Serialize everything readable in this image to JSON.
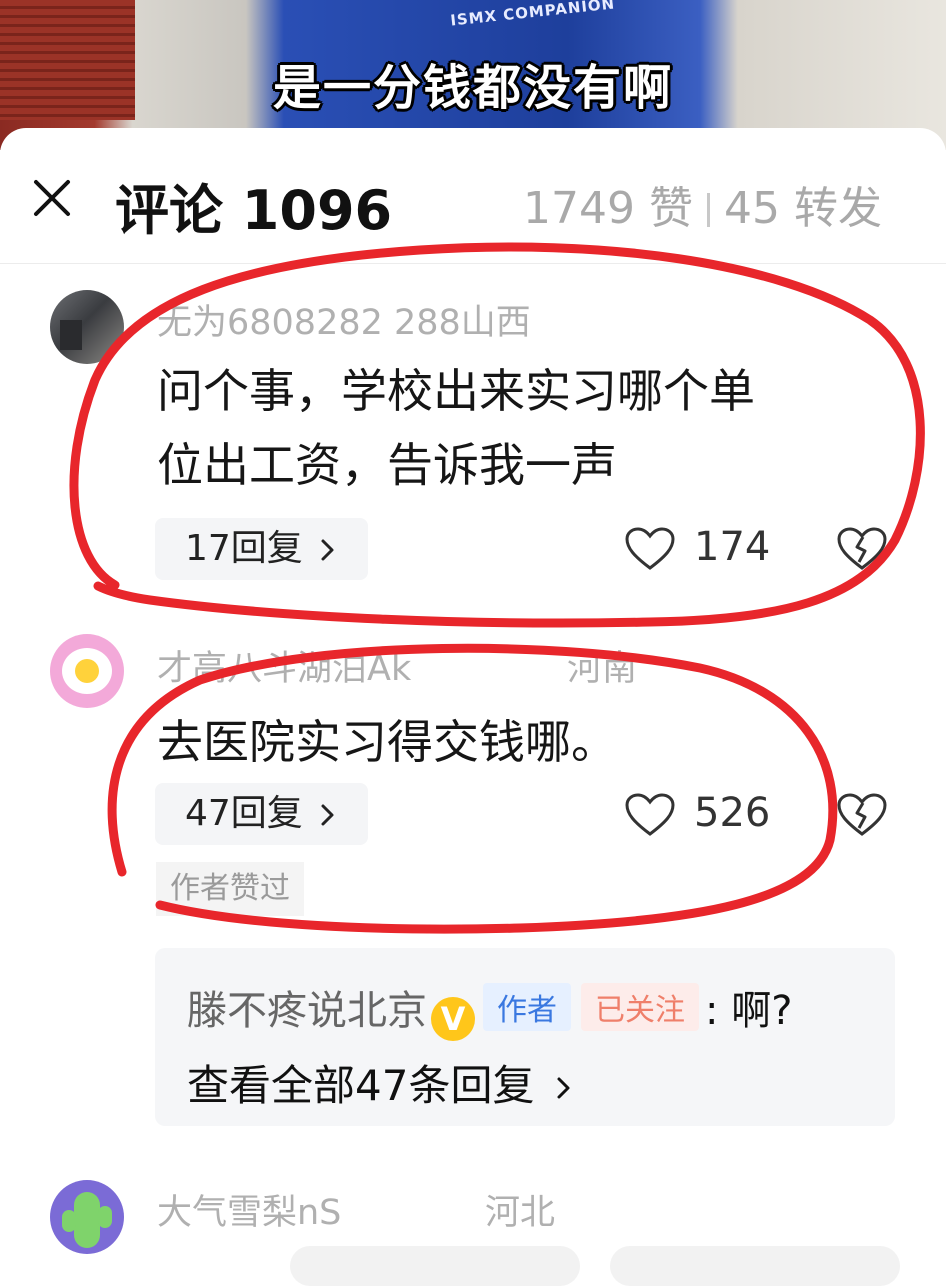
{
  "video": {
    "subtitle": "是一分钱都没有啊",
    "jacket_text": "ISMX COMPANION"
  },
  "header": {
    "title": "评论 1096",
    "likes": "1749 赞",
    "shares": "45 转发"
  },
  "comments": [
    {
      "username": "无为6808282 288山西",
      "text": "问个事，学校出来实习哪个单位出工资，告诉我一声",
      "text_line1": "问个事，学校出来实习哪个单",
      "text_line2": "位出工资，告诉我一声",
      "replies_label": "17回复",
      "like_count": "174"
    },
    {
      "username": "才高八斗湖泊Ak",
      "location": "河南",
      "text": "去医院实习得交钱哪。",
      "replies_label": "47回复",
      "like_count": "526",
      "author_liked": "作者赞过",
      "reply_preview": {
        "name": "滕不疼说北京",
        "verified": "V",
        "author_tag": "作者",
        "follow_tag": "已关注",
        "text": ": 啊?",
        "view_all": "查看全部47条回复"
      }
    },
    {
      "username": "大气雪梨nS",
      "location": "河北"
    }
  ],
  "icons": {
    "close": "close-icon",
    "like": "heart-outline-icon",
    "dislike": "broken-heart-icon",
    "chevron": "chevron-right-icon"
  },
  "colors": {
    "annotation": "#e8262b",
    "verified": "#ffc61a",
    "author_tag": "#3a78e0",
    "follow_tag": "#ef7f6a"
  }
}
